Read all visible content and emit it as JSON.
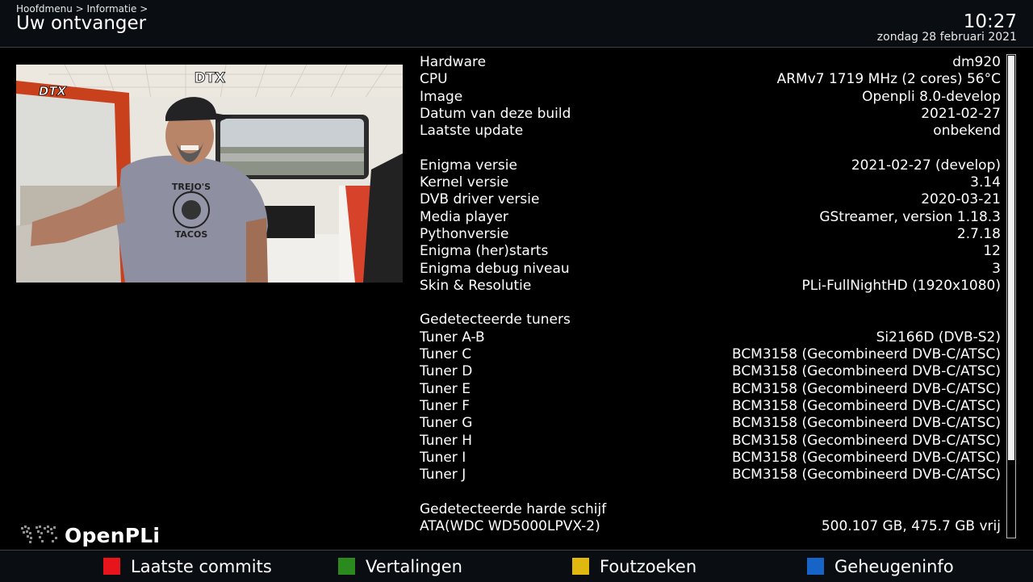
{
  "header": {
    "breadcrumb": "Hoofdmenu > Informatie >",
    "title": "Uw ontvanger",
    "time": "10:27",
    "date": "zondag 28 februari 2021"
  },
  "preview": {
    "channel_label": "DTX",
    "logo_text": "DTX",
    "shirt_text_top": "TREJO'S",
    "shirt_text_bottom": "TACOS"
  },
  "info": {
    "hardware": {
      "label": "Hardware",
      "value": "dm920"
    },
    "cpu": {
      "label": "CPU",
      "value": "ARMv7 1719 MHz (2 cores) 56°C"
    },
    "image": {
      "label": "Image",
      "value": "Openpli 8.0-develop"
    },
    "build_date": {
      "label": "Datum van deze build",
      "value": "2021-02-27"
    },
    "last_update": {
      "label": "Laatste update",
      "value": "onbekend"
    },
    "enigma_version": {
      "label": "Enigma versie",
      "value": "2021-02-27 (develop)"
    },
    "kernel": {
      "label": "Kernel versie",
      "value": "3.14"
    },
    "dvb_driver": {
      "label": "DVB driver versie",
      "value": "2020-03-21"
    },
    "media_player": {
      "label": "Media player",
      "value": "GStreamer, version 1.18.3"
    },
    "python": {
      "label": "Pythonversie",
      "value": "2.7.18"
    },
    "restarts": {
      "label": "Enigma (her)starts",
      "value": "12"
    },
    "debug_level": {
      "label": "Enigma debug niveau",
      "value": "3"
    },
    "skin": {
      "label": "Skin & Resolutie",
      "value": "PLi-FullNightHD (1920x1080)"
    },
    "tuners_heading": "Gedetecteerde tuners",
    "tuners": [
      {
        "label": "Tuner A-B",
        "value": "Si2166D (DVB-S2)"
      },
      {
        "label": "Tuner C",
        "value": "BCM3158 (Gecombineerd DVB-C/ATSC)"
      },
      {
        "label": "Tuner D",
        "value": "BCM3158 (Gecombineerd DVB-C/ATSC)"
      },
      {
        "label": "Tuner E",
        "value": "BCM3158 (Gecombineerd DVB-C/ATSC)"
      },
      {
        "label": "Tuner F",
        "value": "BCM3158 (Gecombineerd DVB-C/ATSC)"
      },
      {
        "label": "Tuner G",
        "value": "BCM3158 (Gecombineerd DVB-C/ATSC)"
      },
      {
        "label": "Tuner H",
        "value": "BCM3158 (Gecombineerd DVB-C/ATSC)"
      },
      {
        "label": "Tuner I",
        "value": "BCM3158 (Gecombineerd DVB-C/ATSC)"
      },
      {
        "label": "Tuner J",
        "value": "BCM3158 (Gecombineerd DVB-C/ATSC)"
      }
    ],
    "hdd_heading": "Gedetecteerde harde schijf",
    "hdd": {
      "label": "ATA(WDC WD5000LPVX-2)",
      "value": "500.107 GB, 475.7 GB vrij"
    }
  },
  "scroll": {
    "position_fraction": 0.84
  },
  "logo": {
    "text": "OpenPLi"
  },
  "footer": {
    "red": {
      "label": "Laatste commits",
      "color": "#e8141c"
    },
    "green": {
      "label": "Vertalingen",
      "color": "#2a8a1e"
    },
    "yellow": {
      "label": "Foutzoeken",
      "color": "#e0b810"
    },
    "blue": {
      "label": "Geheugeninfo",
      "color": "#1664c8"
    }
  }
}
